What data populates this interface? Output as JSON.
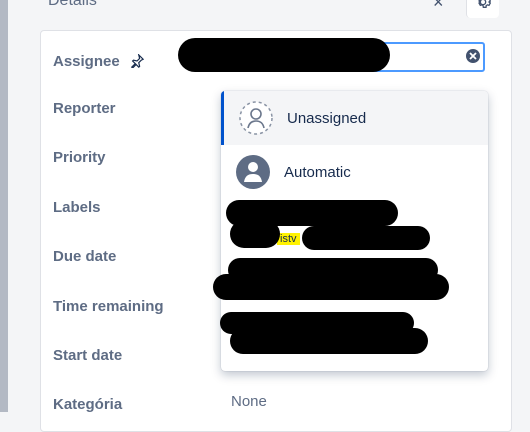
{
  "header": {
    "title": "Details",
    "close_glyph": "×",
    "settings_icon": "gear-icon"
  },
  "fields": {
    "assignee": "Assignee",
    "reporter": "Reporter",
    "priority": "Priority",
    "labels": "Labels",
    "due_date": "Due date",
    "time_remaining": "Time remaining",
    "start_date": "Start date",
    "category": "Kategória"
  },
  "assignee_input": {
    "value": ""
  },
  "dropdown": {
    "options": [
      {
        "label": "Unassigned",
        "icon": "unassigned-avatar-icon"
      },
      {
        "label": "Automatic",
        "icon": "automatic-avatar-icon"
      }
    ],
    "highlight_text": "istv"
  },
  "category_value": "None",
  "colors": {
    "accent": "#0052cc",
    "focus": "#4c9aff",
    "highlight": "#fff200"
  }
}
